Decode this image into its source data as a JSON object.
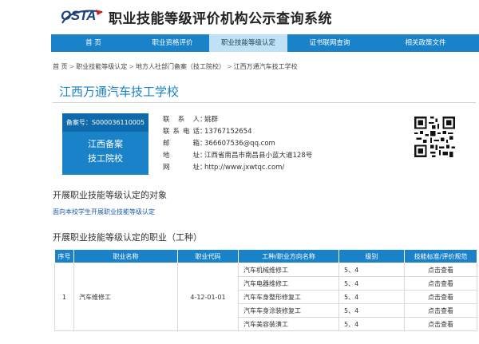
{
  "header": {
    "logo_text": "OSTA",
    "title": "职业技能等级评价机构公示查询系统"
  },
  "nav": {
    "items": [
      {
        "label": "首    页"
      },
      {
        "label": "职业资格评价"
      },
      {
        "label": "职业技能等级认定"
      },
      {
        "label": "证书联网查询"
      },
      {
        "label": "相关政策文件"
      }
    ],
    "active_index": 2
  },
  "breadcrumb": {
    "items": [
      "首 页",
      "职业技能等级认定",
      "地方人社部门备案（技工院校）",
      "江西万通汽车技工学校"
    ],
    "separator": ">"
  },
  "school": {
    "name": "江西万通汽车技工学校"
  },
  "card": {
    "record_id": "备案号：S000036110005",
    "line1": "江西备案",
    "line2": "技工院校"
  },
  "contact": {
    "rows": [
      {
        "label": "联 系 人",
        "value": "姚群"
      },
      {
        "label": "联系电话",
        "value": "13767152654"
      },
      {
        "label": "邮    箱",
        "value": "366607536@qq.com"
      },
      {
        "label": "地    址",
        "value": "江西省南昌市南昌县小蓝大道128号"
      },
      {
        "label": "网    址",
        "value": "http://www.jxwtqc.com/"
      }
    ]
  },
  "sections": {
    "target_title": "开展职业技能等级认定的对象",
    "target_text": "面向本校学生开展职业技能等级认定",
    "occupation_title": "开展职业技能等级认定的职业（工种）"
  },
  "table": {
    "headers": [
      "序号",
      "职业名称",
      "职业代码",
      "工种/职业方向名称",
      "级别",
      "技能标准/评价规范"
    ],
    "occupation": {
      "index": "1",
      "name": "汽车维修工",
      "code": "4-12-01-01"
    },
    "rows": [
      {
        "direction": "汽车机械维修工",
        "level": "5、4",
        "action": "点击查看"
      },
      {
        "direction": "汽车电器维修工",
        "level": "5、4",
        "action": "点击查看"
      },
      {
        "direction": "汽车车身整形修复工",
        "level": "5、4",
        "action": "点击查看"
      },
      {
        "direction": "汽车车身涂装修复工",
        "level": "5、4",
        "action": "点击查看"
      },
      {
        "direction": "汽车美容装潢工",
        "level": "5、4",
        "action": "点击查看"
      }
    ]
  },
  "colors": {
    "primary": "#1a82c8",
    "nav_active": "#bfe1f5",
    "link": "#1a5aa8",
    "title_blue": "#1a82c8"
  },
  "icons": {
    "logo": "osta-logo",
    "home": "home-icon",
    "qr": "qr-code-icon"
  }
}
